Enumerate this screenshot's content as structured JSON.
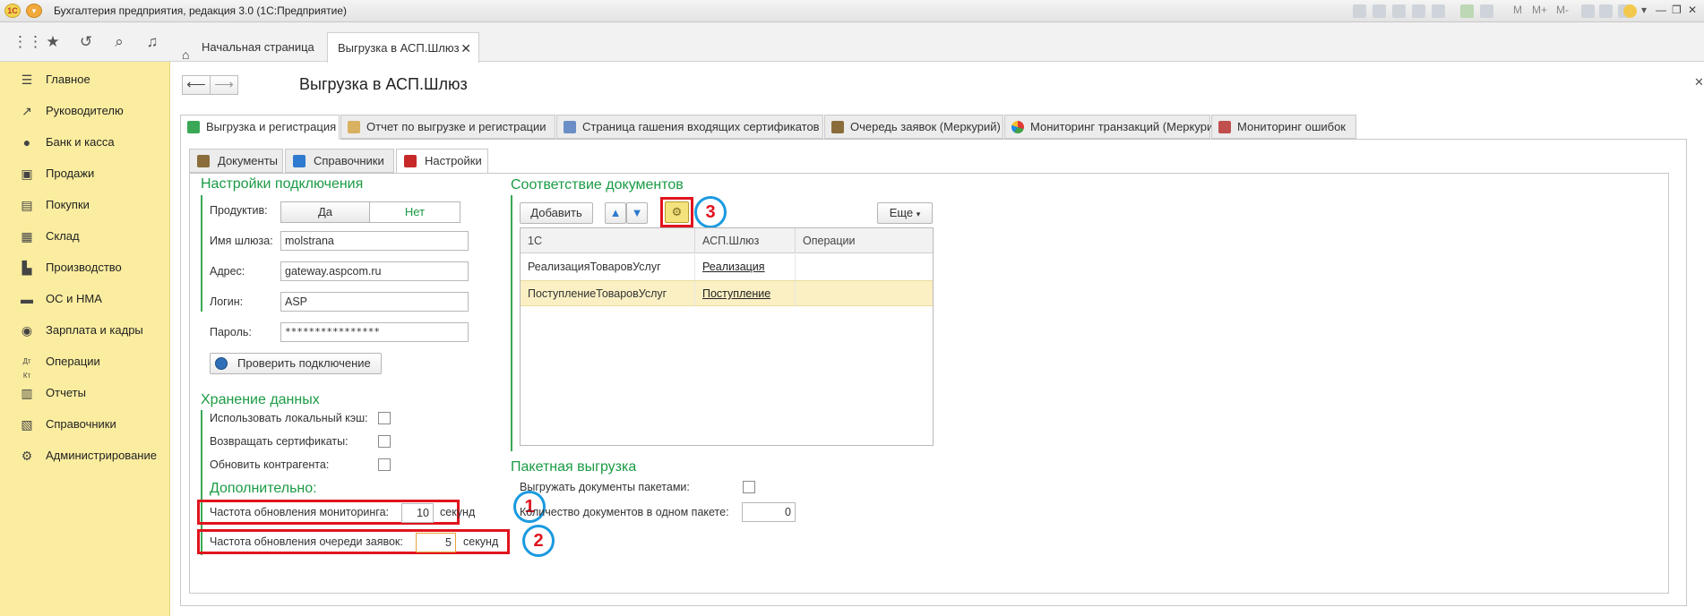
{
  "window": {
    "title": "Бухгалтерия предприятия, редакция 3.0 (1С:Предприятие)",
    "toolbar_letters": [
      "M",
      "M+",
      "M-"
    ]
  },
  "tabs": {
    "home": "Начальная страница",
    "active": "Выгрузка в АСП.Шлюз"
  },
  "sidebar": {
    "items": [
      {
        "label": "Главное",
        "icon": "menu-lines-icon"
      },
      {
        "label": "Руководителю",
        "icon": "trend-icon"
      },
      {
        "label": "Банк и касса",
        "icon": "coin-icon"
      },
      {
        "label": "Продажи",
        "icon": "bag-icon"
      },
      {
        "label": "Покупки",
        "icon": "cart-icon"
      },
      {
        "label": "Склад",
        "icon": "grid-icon"
      },
      {
        "label": "Производство",
        "icon": "factory-icon"
      },
      {
        "label": "ОС и НМА",
        "icon": "truck-icon"
      },
      {
        "label": "Зарплата и кадры",
        "icon": "person-icon"
      },
      {
        "label": "Операции",
        "icon": "dt-kt-icon"
      },
      {
        "label": "Отчеты",
        "icon": "report-icon"
      },
      {
        "label": "Справочники",
        "icon": "book-icon"
      },
      {
        "label": "Администрирование",
        "icon": "gear-icon"
      }
    ]
  },
  "page": {
    "title": "Выгрузка в АСП.Шлюз",
    "top_tabs": [
      "Выгрузка и регистрация",
      "Отчет по выгрузке и регистрации",
      "Страница гашения входящих сертификатов",
      "Очередь заявок (Меркурий)",
      "Мониторинг транзакций (Меркурий)",
      "Мониторинг ошибок"
    ],
    "sub_tabs": [
      "Документы",
      "Справочники",
      "Настройки"
    ]
  },
  "connection": {
    "title": "Настройки подключения",
    "productive_label": "Продуктив:",
    "yes": "Да",
    "no": "Нет",
    "gateway_label": "Имя шлюза:",
    "gateway_value": "molstrana",
    "address_label": "Адрес:",
    "address_value": "gateway.aspcom.ru",
    "login_label": "Логин:",
    "login_value": "ASP",
    "password_label": "Пароль:",
    "password_value": "****************",
    "check_button": "Проверить подключение"
  },
  "storage": {
    "title": "Хранение данных",
    "use_cache": "Использовать локальный кэш:",
    "return_certs": "Возвращать сертификаты:",
    "update_contractor": "Обновить контрагента:"
  },
  "extra": {
    "title": "Дополнительно:",
    "monitoring_label": "Частота обновления мониторинга:",
    "monitoring_value": "10",
    "monitoring_unit": "секунд",
    "queue_label": "Частота обновления очереди заявок:",
    "queue_value": "5",
    "queue_unit": "секунд"
  },
  "docs": {
    "title": "Соответствие документов",
    "add_button": "Добавить",
    "more_button": "Еще",
    "columns": [
      "1С",
      "АСП.Шлюз",
      "Операции"
    ],
    "rows": [
      {
        "c1": "РеализацияТоваровУслуг",
        "c2": "Реализация",
        "c3": ""
      },
      {
        "c1": "ПоступлениеТоваровУслуг",
        "c2": "Поступление",
        "c3": ""
      }
    ]
  },
  "batch": {
    "title": "Пакетная выгрузка",
    "batch_label": "Выгружать документы пакетами:",
    "count_label": "Количество документов в одном пакете:",
    "count_value": "0"
  },
  "annotations": [
    "1",
    "2",
    "3"
  ],
  "colors": {
    "sidebar_bg": "#fbeda0",
    "group_title": "#1a9b44",
    "annotation_red": "#e0141e",
    "annotation_blue": "#1a9ae0",
    "selected_row": "#fbf0c4"
  }
}
